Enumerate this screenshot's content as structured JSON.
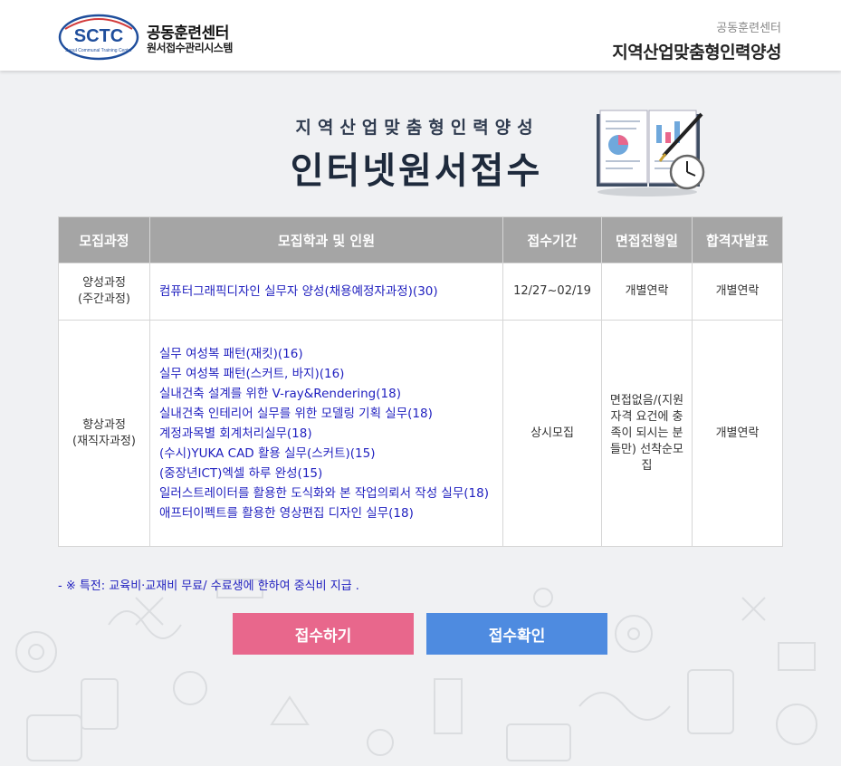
{
  "header": {
    "logo_text": "SCTC",
    "logo_tagline": "Seoul Communal Training Center",
    "org_name": "공동훈련센터",
    "system_name": "원서접수관리시스템",
    "right_sub": "공동훈련센터",
    "right_main": "지역산업맞춤형인력양성"
  },
  "hero": {
    "subtitle": "지역산업맞춤형인력양성",
    "title": "인터넷원서접수"
  },
  "table": {
    "headers": [
      "모집과정",
      "모집학과 및 인원",
      "접수기간",
      "면접전형일",
      "합격자발표"
    ],
    "rows": [
      {
        "category": "양성과정\n(주간과정)",
        "courses": [
          "컴퓨터그래픽디자인 실무자 양성(채용예정자과정)(30)"
        ],
        "period": "12/27~02/19",
        "interview": "개별연락",
        "result": "개별연락"
      },
      {
        "category": "향상과정\n(재직자과정)",
        "courses": [
          "실무 여성복 패턴(재킷)(16)",
          "실무 여성복 패턴(스커트, 바지)(16)",
          "실내건축 설계를 위한 V-ray&Rendering(18)",
          "실내건축 인테리어 실무를 위한 모델링 기획 실무(18)",
          "계정과목별 회계처리실무(18)",
          "(수시)YUKA CAD 활용 실무(스커트)(15)",
          "(중장년ICT)엑셀 하루 완성(15)",
          "일러스트레이터를 활용한 도식화와 본 작업의뢰서 작성 실무(18)",
          "애프터이펙트를 활용한 영상편집 디자인 실무(18)"
        ],
        "period": "상시모집",
        "interview": "면접없음/(지원 자격 요건에 충족이 되시는 분들만) 선착순모집",
        "result": "개별연락"
      }
    ]
  },
  "note": "- ※ 특전: 교육비·교재비 무료/ 수료생에 한하여 중식비 지급 .",
  "buttons": {
    "apply": "접수하기",
    "check": "접수확인"
  },
  "colors": {
    "apply_button": "#e8678c",
    "check_button": "#4e8be0",
    "header_cell": "#a5a5a5",
    "link_text": "#1f1fbf",
    "logo_blue": "#1f4e9c"
  }
}
